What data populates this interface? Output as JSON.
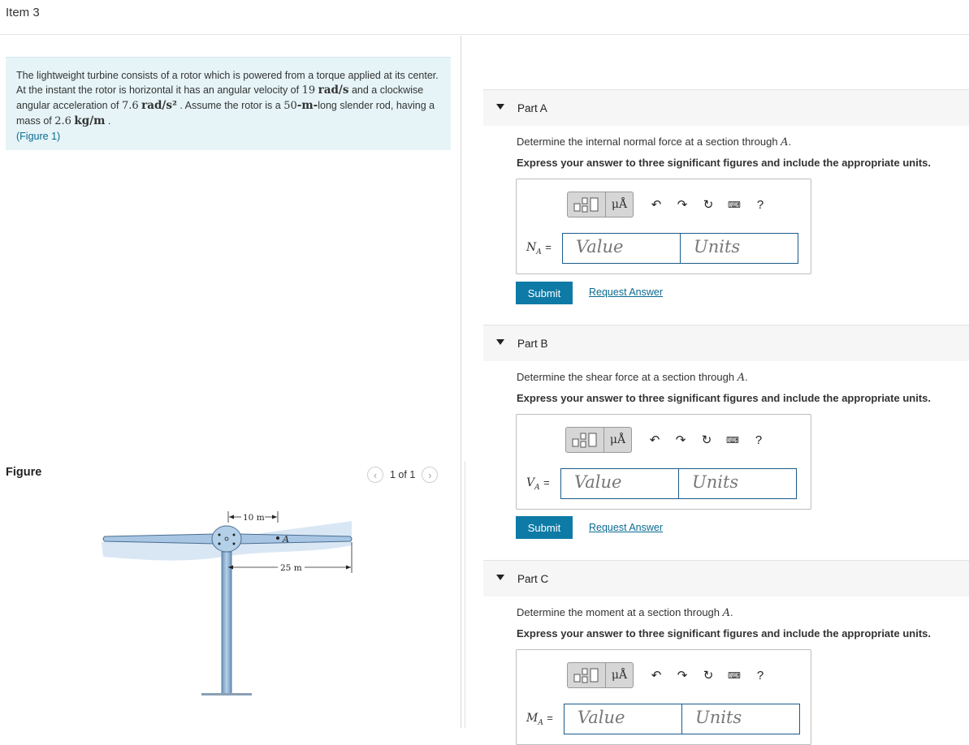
{
  "page": {
    "item_title": "Item 3"
  },
  "problem": {
    "t1": "The lightweight turbine consists of a rotor which is powered from a torque applied at its center. At the instant the rotor is horizontal it has an angular velocity of ",
    "omega": "19",
    "omega_unit": "rad/s",
    "t2": " and a clockwise angular acceleration of ",
    "alpha": "7.6",
    "alpha_unit": "rad/s²",
    "t3": " . Assume the rotor is a ",
    "length": "50",
    "length_unit": "-m-",
    "t4": "long slender rod, having a mass of ",
    "mass": "2.6",
    "mass_unit": "kg/m",
    "t5": " .",
    "figure_link": "(Figure 1)"
  },
  "figure": {
    "label": "Figure",
    "pager_text": "1 of 1",
    "prev_icon": "chevron-left-icon",
    "next_icon": "chevron-right-icon",
    "dim_10": "10 m",
    "dim_25": "25 m",
    "point_label": "A",
    "colors": {
      "rod": "#9fbfe0",
      "rod_edge": "#4a6d8f",
      "blur": "#c9def2"
    }
  },
  "toolbar": {
    "mu_label": "μÅ",
    "undo": "↶",
    "redo": "↷",
    "reset": "↻",
    "keyboard": "⌨",
    "help": "?"
  },
  "parts": [
    {
      "label": "Part A",
      "question": "Determine the internal normal force at a section through ",
      "point": "A",
      "instruction": "Express your answer to three significant figures and include the appropriate units.",
      "var": "N",
      "sub": "A",
      "value_placeholder": "Value",
      "units_placeholder": "Units",
      "submit": "Submit",
      "request": "Request Answer"
    },
    {
      "label": "Part B",
      "question": "Determine the shear force at a section through ",
      "point": "A",
      "instruction": "Express your answer to three significant figures and include the appropriate units.",
      "var": "V",
      "sub": "A",
      "value_placeholder": "Value",
      "units_placeholder": "Units",
      "submit": "Submit",
      "request": "Request Answer"
    },
    {
      "label": "Part C",
      "question": "Determine the moment at a section through ",
      "point": "A",
      "instruction": "Express your answer to three significant figures and include the appropriate units.",
      "var": "M",
      "sub": "A",
      "value_placeholder": "Value",
      "units_placeholder": "Units"
    }
  ],
  "colors": {
    "accent": "#0e7aa6",
    "problem_bg": "#e6f4f7",
    "link": "#0b6a92"
  }
}
